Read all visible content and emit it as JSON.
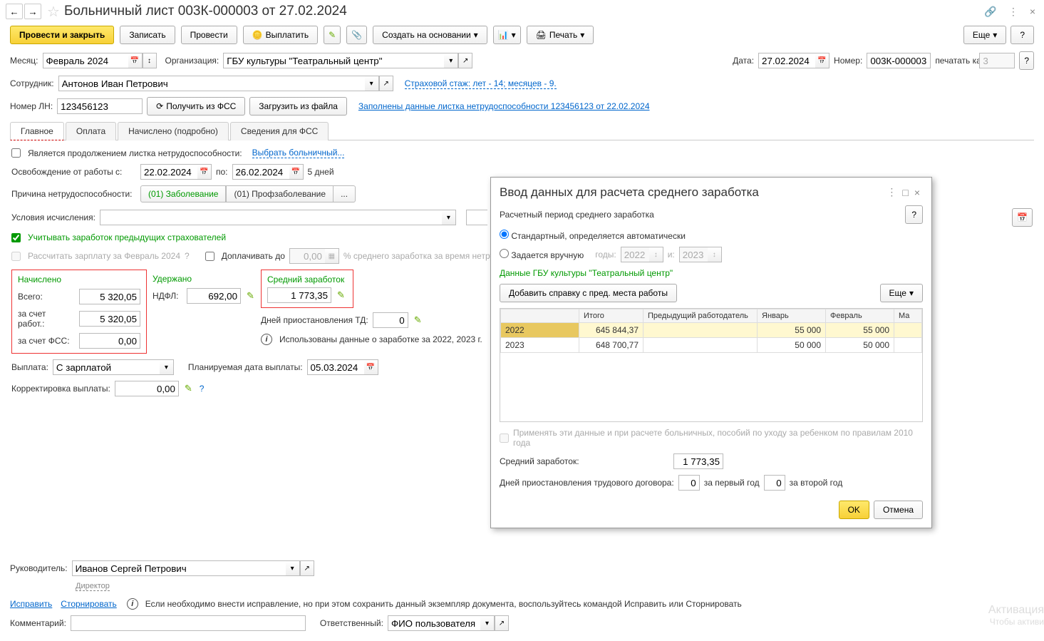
{
  "title": "Больничный лист 003К-000003 от 27.02.2024",
  "toolbar": {
    "post_close": "Провести и закрыть",
    "save": "Записать",
    "post": "Провести",
    "pay": "Выплатить",
    "create_based": "Создать на основании",
    "print": "Печать",
    "more": "Еще",
    "help": "?"
  },
  "header": {
    "month_label": "Месяц:",
    "month": "Февраль 2024",
    "org_label": "Организация:",
    "org": "ГБУ культуры \"Театральный центр\"",
    "date_label": "Дата:",
    "date": "27.02.2024",
    "number_label": "Номер:",
    "number": "003К-000003",
    "print_as_label": "печатать как:",
    "print_as": "3",
    "employee_label": "Сотрудник:",
    "employee": "Антонов Иван Петрович",
    "insurance_link": "Страховой стаж: лет - 14; месяцев - 9.",
    "ln_label": "Номер ЛН:",
    "ln": "123456123",
    "get_fss": "Получить из ФСС",
    "load_file": "Загрузить из файла",
    "ln_filled_link": "Заполнены данные листка нетрудоспособности 123456123 от 22.02.2024"
  },
  "tabs": [
    "Главное",
    "Оплата",
    "Начислено (подробно)",
    "Сведения для ФСС"
  ],
  "main": {
    "continuation_label": "Является продолжением листка нетрудоспособности:",
    "select_sick": "Выбрать больничный...",
    "release_label": "Освобождение от работы с:",
    "date_from": "22.02.2024",
    "to_label": "по:",
    "date_to": "26.02.2024",
    "days": "5 дней",
    "reason_label": "Причина нетрудоспособности:",
    "reason1": "(01) Заболевание",
    "reason2": "(01) Профзаболевание",
    "reason_more": "...",
    "calc_cond_label": "Условия исчисления:",
    "prev_insurers": "Учитывать заработок предыдущих страхователей",
    "recalc_salary": "Рассчитать зарплату за Февраль 2024",
    "pay_up_to": "Доплачивать до",
    "pay_up_val": "0,00",
    "pay_up_suffix": "% среднего заработка за время нетрудоспо",
    "accrued_title": "Начислено",
    "total_label": "Всего:",
    "total": "5 320,05",
    "employer_label": "за счет работ.:",
    "employer": "5 320,05",
    "fss_label": "за счет ФСС:",
    "fss": "0,00",
    "withheld_title": "Удержано",
    "ndfl_label": "НДФЛ:",
    "ndfl": "692,00",
    "avg_title": "Средний заработок",
    "avg": "1 773,35",
    "suspension_label": "Дней приостановления ТД:",
    "suspension": "0",
    "info_text": "Использованы данные о заработке за  2022,  2023 г.",
    "payment_label": "Выплата:",
    "payment": "С зарплатой",
    "planned_date_label": "Планируемая дата выплаты:",
    "planned_date": "05.03.2024",
    "correction_label": "Корректировка выплаты:",
    "correction": "0,00"
  },
  "footer": {
    "manager_label": "Руководитель:",
    "manager": "Иванов Сергей Петрович",
    "director": "Директор",
    "fix": "Исправить",
    "reverse": "Сторнировать",
    "info": "Если необходимо внести исправление, но при этом сохранить данный экземпляр документа, воспользуйтесь командой Исправить или Сторнировать",
    "comment_label": "Комментарий:",
    "responsible_label": "Ответственный:",
    "responsible": "ФИО пользователя"
  },
  "popup": {
    "title": "Ввод данных для расчета среднего заработка",
    "period_label": "Расчетный период среднего заработка",
    "opt1": "Стандартный, определяется автоматически",
    "opt2": "Задается вручную",
    "years_label": "годы:",
    "year1": "2022",
    "and": "и:",
    "year2": "2023",
    "data_label": "Данные ГБУ культуры \"Театральный центр\"",
    "add_ref": "Добавить справку с пред. места работы",
    "more": "Еще",
    "help": "?",
    "cols": [
      "",
      "Итого",
      "Предыдущий работодатель",
      "Январь",
      "Февраль",
      "Ма"
    ],
    "rows": [
      {
        "year": "2022",
        "total": "645 844,37",
        "prev": "",
        "jan": "55 000",
        "feb": "55 000"
      },
      {
        "year": "2023",
        "total": "648 700,77",
        "prev": "",
        "jan": "50 000",
        "feb": "50 000"
      }
    ],
    "apply_rule": "Применять эти данные и при расчете больничных, пособий по уходу за ребенком по правилам 2010 года",
    "avg_label": "Средний заработок:",
    "avg": "1 773,35",
    "susp_label": "Дней приостановления трудового договора:",
    "susp1": "0",
    "susp1_suf": "за первый год",
    "susp2": "0",
    "susp2_suf": "за второй год",
    "ok": "OK",
    "cancel": "Отмена"
  },
  "watermark": {
    "l1": "Активация",
    "l2": "Чтобы активи"
  }
}
